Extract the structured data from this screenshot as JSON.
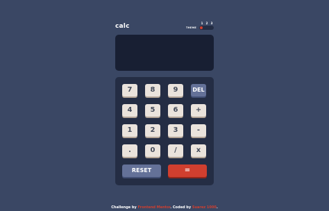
{
  "header": {
    "title": "calc",
    "theme_label": "THEME",
    "theme_options": [
      "1",
      "2",
      "3"
    ],
    "theme_selected": "1"
  },
  "screen": {
    "value": ""
  },
  "keypad": {
    "keys": [
      "7",
      "8",
      "9",
      "DEL",
      "4",
      "5",
      "6",
      "+",
      "1",
      "2",
      "3",
      "-",
      ".",
      "0",
      "/",
      "x"
    ],
    "reset_label": "RESET",
    "equals_label": "="
  },
  "footer": {
    "prefix": "Challenge by",
    "challenge_link": "Frontend Mentor",
    "middle": ". Coded by",
    "coder_link": "Suarez 1000",
    "suffix": "."
  },
  "colors": {
    "page_bg": "#3a4764",
    "keypad_bg": "#242d44",
    "screen_bg": "#181f33",
    "key_bg": "#eae3dc",
    "function_key_bg": "#647198",
    "accent": "#d03f2f"
  }
}
